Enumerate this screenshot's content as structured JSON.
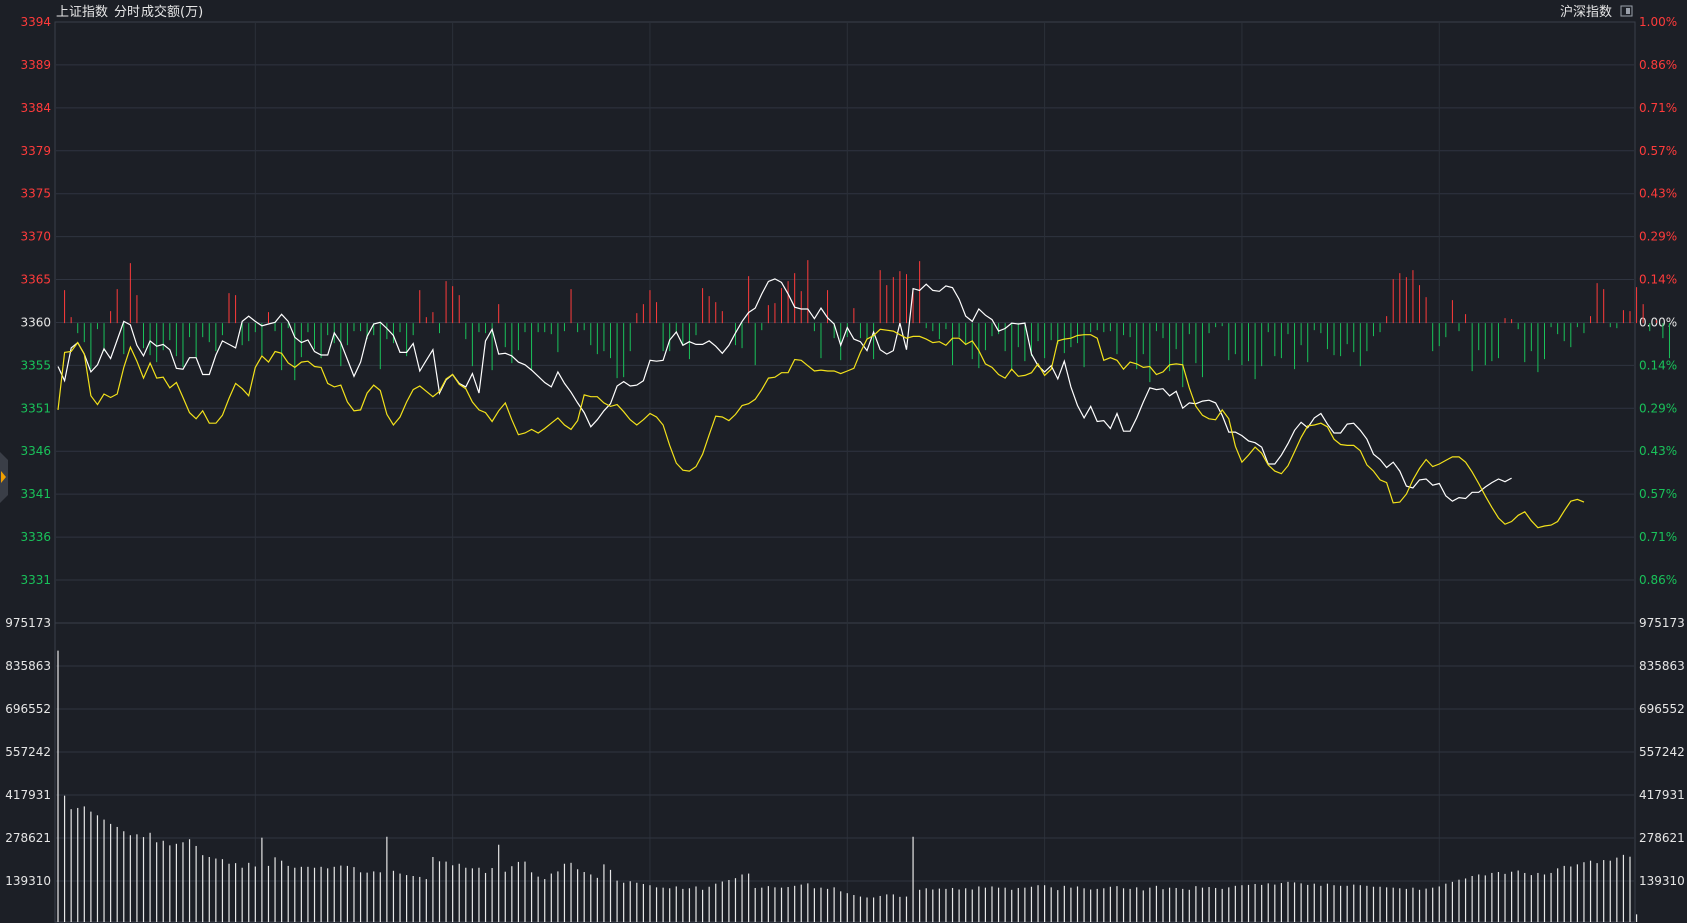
{
  "header": {
    "index_name": "上证指数",
    "mode_label": "分时",
    "volume_label": "成交额(万)",
    "market_label": "沪深指数"
  },
  "colors": {
    "background": "#1c1f26",
    "up": "#ff3b3b",
    "down": "#19c25a",
    "price_line": "#ffffff",
    "avg_line": "#f2e11b",
    "volume_bar": "#e6e6e6"
  },
  "chart_data": [
    {
      "type": "line",
      "title": "",
      "baseline": 3360,
      "y_left_ticks": [
        "3394",
        "3389",
        "3384",
        "3379",
        "3375",
        "3370",
        "3365",
        "3360",
        "3355",
        "3351",
        "3346",
        "3341",
        "3336",
        "3331"
      ],
      "y_right_ticks": [
        "1.00%",
        "0.86%",
        "0.71%",
        "0.57%",
        "0.43%",
        "0.29%",
        "0.14%",
        "0.00%",
        "0.14%",
        "0.29%",
        "0.43%",
        "0.57%",
        "0.71%",
        "0.86%"
      ],
      "ylim": [
        3326,
        3394
      ],
      "xlim": [
        0,
        240
      ],
      "series": [
        {
          "key": "price",
          "values": [
            3355.1,
            3353.5,
            3357.2,
            3357.8,
            3356.5,
            3354.5,
            3355.3,
            3357.1,
            3356.0,
            3358.1,
            3360.2,
            3359.8,
            3357.5,
            3356.3,
            3358.0,
            3357.4,
            3357.6,
            3357.0,
            3354.9,
            3354.8,
            3356.1,
            3356.1,
            3354.2,
            3354.2,
            3356.4,
            3358.0,
            3357.6,
            3357.2,
            3360.2,
            3360.8,
            3360.2,
            3359.7,
            3359.9,
            3360.1,
            3361.0,
            3360.2,
            3358.4,
            3357.8,
            3358.1,
            3356.8,
            3356.4,
            3356.4,
            3358.9,
            3357.8,
            3355.9,
            3354.0,
            3355.6,
            3358.5,
            3359.9,
            3360.1,
            3359.4,
            3358.6,
            3356.7,
            3356.7,
            3357.7,
            3354.6,
            3355.8,
            3357.0,
            3352.1,
            3353.6,
            3354.2,
            3353.2,
            3352.8,
            3354.3,
            3352.1,
            3358.0,
            3359.3,
            3356.5,
            3356.6,
            3356.3,
            3355.6,
            3355.3,
            3354.7,
            3354.0,
            3353.3,
            3352.8,
            3354.5,
            3353.2,
            3352.2,
            3351.0,
            3349.9,
            3348.3,
            3349.1,
            3350.1,
            3350.9,
            3352.9,
            3353.4,
            3352.9,
            3353.0,
            3353.5,
            3355.8,
            3355.7,
            3355.8,
            3358.1,
            3359.0,
            3357.5,
            3357.9,
            3357.6,
            3357.6,
            3358.0,
            3357.4,
            3356.6,
            3357.5,
            3358.9,
            3360.2,
            3361.2,
            3361.7,
            3363.3,
            3364.7,
            3365.0,
            3364.6,
            3363.3,
            3361.8,
            3361.6,
            3361.6,
            3360.5,
            3361.7,
            3360.6,
            3359.9,
            3357.5,
            3359.5,
            3358.2,
            3357.9,
            3356.9,
            3359.0,
            3357.0,
            3356.5,
            3356.9,
            3360.0,
            3357.0,
            3363.9,
            3363.7,
            3364.4,
            3363.7,
            3363.6,
            3364.2,
            3364.0,
            3362.7,
            3360.8,
            3360.2,
            3361.6,
            3360.9,
            3360.4,
            3359.1,
            3359.4,
            3360.0,
            3359.9,
            3360.0,
            3356.5,
            3355.2,
            3354.5,
            3355.2,
            3353.7,
            3355.7,
            3352.8,
            3350.7,
            3349.3,
            3350.6,
            3348.9,
            3349.0,
            3348.1,
            3349.8,
            3347.8,
            3347.8,
            3349.3,
            3351.1,
            3352.7,
            3352.5,
            3352.6,
            3351.8,
            3352.3,
            3350.4,
            3351.0,
            3350.9,
            3351.2,
            3351.3,
            3351.0,
            3349.6,
            3347.7,
            3347.7,
            3347.3,
            3346.7,
            3346.5,
            3346.0,
            3344.1,
            3344.1,
            3345.1,
            3346.4,
            3347.9,
            3348.8,
            3348.2,
            3349.3,
            3349.8,
            3348.6,
            3347.6,
            3347.6,
            3348.6,
            3348.7,
            3347.9,
            3346.9,
            3345.2,
            3344.6,
            3343.7,
            3344.3,
            3343.3,
            3341.6,
            3341.4,
            3342.3,
            3342.4,
            3341.7,
            3341.9,
            3340.5,
            3339.9,
            3340.3,
            3340.2,
            3340.9,
            3340.9,
            3341.5,
            3342.0,
            3342.4,
            3342.1,
            3342.5
          ]
        },
        {
          "key": "average",
          "values": [
            3350.2,
            3356.7,
            3356.8,
            3357.8,
            3356.5,
            3351.8,
            3350.8,
            3352.0,
            3351.6,
            3352.0,
            3355.0,
            3357.3,
            3355.7,
            3353.8,
            3355.5,
            3353.8,
            3353.9,
            3352.7,
            3353.3,
            3351.6,
            3349.9,
            3349.2,
            3350.1,
            3348.7,
            3348.7,
            3349.6,
            3351.5,
            3353.2,
            3352.6,
            3351.8,
            3355.0,
            3356.3,
            3355.6,
            3356.8,
            3356.6,
            3355.5,
            3355.0,
            3355.6,
            3355.7,
            3355.1,
            3355.0,
            3353.2,
            3352.8,
            3353.0,
            3351.1,
            3350.1,
            3350.2,
            3352.1,
            3353.0,
            3352.4,
            3349.7,
            3348.5,
            3349.4,
            3351.1,
            3352.5,
            3352.9,
            3352.3,
            3351.7,
            3352.3,
            3353.7,
            3354.2,
            3353.1,
            3352.6,
            3351.1,
            3350.2,
            3349.9,
            3348.9,
            3350.1,
            3351.0,
            3349.1,
            3347.4,
            3347.6,
            3348.0,
            3347.6,
            3348.1,
            3348.7,
            3349.3,
            3348.5,
            3348.0,
            3349.0,
            3351.9,
            3351.7,
            3351.7,
            3351.0,
            3350.6,
            3350.8,
            3350.0,
            3349.1,
            3348.5,
            3349.1,
            3349.8,
            3349.4,
            3348.5,
            3346.2,
            3344.2,
            3343.4,
            3343.3,
            3343.8,
            3345.2,
            3347.4,
            3349.5,
            3349.4,
            3349.0,
            3349.7,
            3350.7,
            3350.9,
            3351.4,
            3352.5,
            3353.8,
            3353.9,
            3354.4,
            3354.4,
            3355.9,
            3355.8,
            3355.2,
            3354.6,
            3354.7,
            3354.6,
            3354.6,
            3354.3,
            3354.6,
            3354.9,
            3356.7,
            3358.2,
            3358.6,
            3359.3,
            3359.2,
            3359.1,
            3358.7,
            3358.3,
            3358.5,
            3358.5,
            3358.2,
            3357.8,
            3357.9,
            3357.5,
            3358.3,
            3358.3,
            3357.6,
            3358.0,
            3356.9,
            3355.4,
            3355.0,
            3354.2,
            3353.8,
            3354.8,
            3354.0,
            3354.1,
            3354.4,
            3355.4,
            3354.1,
            3354.8,
            3358.0,
            3358.2,
            3358.3,
            3358.6,
            3358.7,
            3358.7,
            3358.3,
            3355.8,
            3356.1,
            3355.8,
            3354.8,
            3355.6,
            3355.4,
            3355.0,
            3355.1,
            3354.2,
            3354.5,
            3355.3,
            3355.4,
            3355.3,
            3352.7,
            3350.6,
            3349.6,
            3349.2,
            3349.1,
            3350.2,
            3349.2,
            3346.1,
            3344.3,
            3345.1,
            3346.0,
            3345.3,
            3344.0,
            3343.3,
            3343.0,
            3343.9,
            3345.5,
            3347.1,
            3348.4,
            3348.5,
            3348.7,
            3348.3,
            3346.9,
            3346.3,
            3346.2,
            3346.2,
            3345.6,
            3344.0,
            3343.3,
            3342.3,
            3342.0,
            3339.7,
            3339.8,
            3340.7,
            3342.3,
            3343.6,
            3344.6,
            3343.8,
            3344.1,
            3344.5,
            3344.9,
            3344.9,
            3344.3,
            3343.2,
            3341.9,
            3340.5,
            3339.2,
            3338.0,
            3337.3,
            3337.6,
            3338.3,
            3338.7,
            3337.7,
            3336.9,
            3337.1,
            3337.2,
            3337.6,
            3338.8,
            3339.9,
            3340.1,
            3339.8
          ]
        }
      ]
    },
    {
      "type": "bar",
      "title": "",
      "note": "net buying (+) / selling (-) strength bars around baseline",
      "ylim": [
        -8,
        8
      ],
      "values": [
        0,
        3.3,
        0.6,
        -1.0,
        -1.9,
        -4.6,
        -0.6,
        -2.8,
        1.2,
        3.4,
        -3.1,
        6.0,
        2.8,
        -2.5,
        -3.2,
        -3.9,
        -2.7,
        -1.7,
        -3.3,
        -4.4,
        -1.4,
        -3.5,
        -1.4,
        -1.9,
        -2.8,
        -1.2,
        3.0,
        2.8,
        -2.2,
        -1.8,
        -0.9,
        -3.2,
        1.1,
        -0.8,
        -4.7,
        -0.5,
        -5.7,
        -3.4,
        -0.9,
        -2.6,
        -3.5,
        -1.2,
        -2.0,
        -4.3,
        -2.2,
        -0.8,
        -0.8,
        -1.6,
        -1.2,
        -4.6,
        -1.6,
        -2.0,
        -0.9,
        -3.3,
        -1.2,
        3.3,
        0.6,
        1.1,
        -1.0,
        4.2,
        3.7,
        2.8,
        -1.6,
        -4.3,
        -0.9,
        -1.0,
        -4.7,
        1.9,
        -2.4,
        -4.0,
        -2.7,
        -0.9,
        -4.7,
        -0.9,
        -0.9,
        -1.1,
        -2.9,
        -0.8,
        3.4,
        -0.9,
        -0.7,
        -2.2,
        -3.1,
        -2.8,
        -3.5,
        -5.5,
        -5.4,
        -2.8,
        1.0,
        1.9,
        3.3,
        2.1,
        -2.8,
        -2.8,
        -1.0,
        -2.2,
        -3.6,
        -1.2,
        3.5,
        2.7,
        2.1,
        1.2,
        0,
        -2.2,
        -2.5,
        4.7,
        -4.2,
        -0.7,
        1.8,
        2.0,
        3.5,
        4.2,
        5.0,
        3.2,
        6.3,
        -0.8,
        -3.5,
        3.3,
        -1.5,
        -3.7,
        -1.4,
        1.5,
        -1.5,
        -1.6,
        -3.6,
        5.3,
        3.8,
        4.6,
        5.2,
        4.9,
        3.3,
        6.2,
        -0.5,
        -0.8,
        -1.6,
        -0.6,
        -4.2,
        -1.4,
        -2.2,
        -3.6,
        -4.5,
        -2.7,
        -1.3,
        -1.1,
        -2.8,
        -4.6,
        -2.4,
        -3.8,
        -3.3,
        -1.8,
        -3.5,
        -1.7,
        -2.1,
        -3.0,
        -2.4,
        -2.0,
        -4.4,
        -0.9,
        -0.7,
        -0.9,
        -0.8,
        -3.1,
        -1.2,
        -1.4,
        -4.6,
        -3.1,
        -5.9,
        -0.8,
        -1.5,
        -4.8,
        -2.6,
        -6.4,
        -1.1,
        -4.0,
        -5.4,
        -1.0,
        -0.4,
        -0.3,
        -3.7,
        -3.1,
        -4.2,
        -3.8,
        -5.6,
        -4.3,
        -0.9,
        -3.3,
        -3.5,
        -1.1,
        -4.6,
        -2.2,
        -3.9,
        -0.7,
        -1.0,
        -2.6,
        -3.2,
        -3.3,
        -2.1,
        -2.9,
        -4.3,
        -2.8,
        -1.3,
        -0.9,
        0.7,
        4.4,
        5.0,
        4.6,
        5.3,
        3.8,
        2.6,
        -2.8,
        -2.3,
        -1.4,
        2.3,
        -0.8,
        0.9,
        -4.8,
        -2.7,
        -4.2,
        -3.8,
        -3.5,
        0.5,
        0.4,
        -0.6,
        -3.9,
        -2.8,
        -4.9,
        -3.6,
        -0.4,
        -1.1,
        -1.8,
        -2.4,
        -0.4,
        -1.0,
        0.7,
        4.0,
        3.4,
        -0.4,
        -0.5,
        1.3,
        1.2,
        3.6,
        1.9,
        -0.8,
        0.3,
        -1.5,
        -3.5
      ]
    },
    {
      "type": "bar",
      "title": "",
      "series_name": "成交额(万)",
      "y_ticks": [
        "975173",
        "835863",
        "696552",
        "557242",
        "417931",
        "278621",
        "139310"
      ],
      "ylim": [
        0,
        975173
      ],
      "values": [
        885000,
        412000,
        368000,
        372000,
        377000,
        360000,
        348000,
        334000,
        320000,
        310000,
        296000,
        283000,
        286000,
        277000,
        291000,
        260000,
        265000,
        250000,
        255000,
        260000,
        270000,
        248000,
        218000,
        212000,
        207000,
        205000,
        190000,
        192000,
        177000,
        193000,
        181000,
        275000,
        183000,
        211000,
        200000,
        183000,
        177000,
        180000,
        180000,
        177000,
        180000,
        175000,
        180000,
        184000,
        183000,
        179000,
        162000,
        161000,
        165000,
        162000,
        278000,
        167000,
        158000,
        153000,
        150000,
        147000,
        140000,
        212000,
        198000,
        197000,
        185000,
        190000,
        177000,
        175000,
        177000,
        160000,
        176000,
        252000,
        164000,
        182000,
        196000,
        197000,
        162000,
        148000,
        140000,
        158000,
        165000,
        190000,
        193000,
        172000,
        163000,
        155000,
        144000,
        188000,
        170000,
        135000,
        128000,
        133000,
        128000,
        124000,
        120000,
        113000,
        112000,
        110000,
        116000,
        108000,
        110000,
        116000,
        105000,
        115000,
        125000,
        132000,
        137000,
        143000,
        155000,
        158000,
        111000,
        112000,
        117000,
        113000,
        112000,
        114000,
        118000,
        122000,
        126000,
        110000,
        112000,
        108000,
        113000,
        100000,
        94000,
        88000,
        83000,
        80000,
        80000,
        85000,
        90000,
        90000,
        82000,
        83000,
        278000,
        105000,
        110000,
        106000,
        109000,
        108000,
        111000,
        106000,
        110000,
        106000,
        116000,
        112000,
        116000,
        112000,
        112000,
        105000,
        111000,
        112000,
        115000,
        120000,
        120000,
        113000,
        104000,
        118000,
        112000,
        116000,
        110000,
        106000,
        108000,
        110000,
        115000,
        117000,
        110000,
        108000,
        113000,
        103000,
        112000,
        118000,
        107000,
        112000,
        111000,
        108000,
        105000,
        117000,
        112000,
        114000,
        111000,
        108000,
        113000,
        118000,
        120000,
        121000,
        124000,
        121000,
        126000,
        122000,
        127000,
        131000,
        129000,
        126000,
        121000,
        125000,
        118000,
        125000,
        120000,
        118000,
        118000,
        122000,
        120000,
        118000,
        115000,
        115000,
        113000,
        112000,
        110000,
        108000,
        112000,
        105000,
        109000,
        112000,
        116000,
        125000,
        131000,
        138000,
        142000,
        150000,
        155000,
        152000,
        160000,
        163000,
        157000,
        164000,
        168000,
        160000,
        153000,
        160000,
        155000,
        160000,
        175000,
        183000,
        181000,
        188000,
        195000,
        200000,
        192000,
        202000,
        200000,
        210000,
        219000,
        213000,
        25000
      ]
    }
  ]
}
